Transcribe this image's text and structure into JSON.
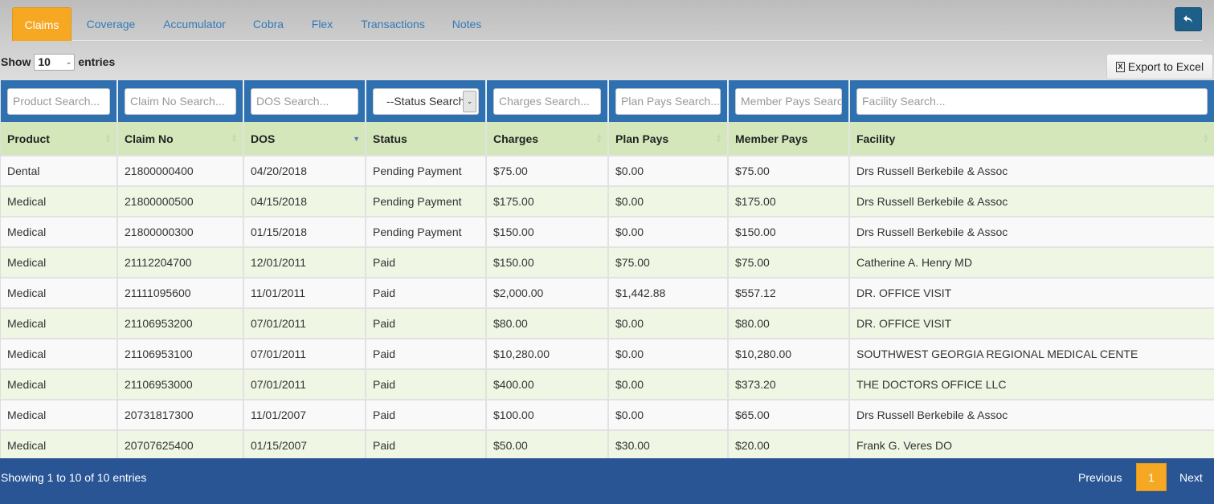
{
  "tabs": [
    "Claims",
    "Coverage",
    "Accumulator",
    "Cobra",
    "Flex",
    "Transactions",
    "Notes"
  ],
  "active_tab": "Claims",
  "length_menu": {
    "prefix": "Show",
    "value": "10",
    "suffix": "entries"
  },
  "export_label": "Export to Excel",
  "search": {
    "product": "Product Search...",
    "claim_no": "Claim No Search...",
    "dos": "DOS Search...",
    "status": "--Status Search--",
    "charges": "Charges Search...",
    "plan_pays": "Plan Pays Search...",
    "member_pays": "Member Pays Search...",
    "facility": "Facility Search..."
  },
  "columns": [
    "Product",
    "Claim No",
    "DOS",
    "Status",
    "Charges",
    "Plan Pays",
    "Member Pays",
    "Facility"
  ],
  "sorted_column": "DOS",
  "sort_direction": "desc",
  "rows": [
    [
      "Dental",
      "21800000400",
      "04/20/2018",
      "Pending Payment",
      "$75.00",
      "$0.00",
      "$75.00",
      "Drs Russell Berkebile & Assoc"
    ],
    [
      "Medical",
      "21800000500",
      "04/15/2018",
      "Pending Payment",
      "$175.00",
      "$0.00",
      "$175.00",
      "Drs Russell Berkebile & Assoc"
    ],
    [
      "Medical",
      "21800000300",
      "01/15/2018",
      "Pending Payment",
      "$150.00",
      "$0.00",
      "$150.00",
      "Drs Russell Berkebile & Assoc"
    ],
    [
      "Medical",
      "21112204700",
      "12/01/2011",
      "Paid",
      "$150.00",
      "$75.00",
      "$75.00",
      "Catherine A. Henry MD"
    ],
    [
      "Medical",
      "21111095600",
      "11/01/2011",
      "Paid",
      "$2,000.00",
      "$1,442.88",
      "$557.12",
      "DR. OFFICE VISIT"
    ],
    [
      "Medical",
      "21106953200",
      "07/01/2011",
      "Paid",
      "$80.00",
      "$0.00",
      "$80.00",
      "DR. OFFICE VISIT"
    ],
    [
      "Medical",
      "21106953100",
      "07/01/2011",
      "Paid",
      "$10,280.00",
      "$0.00",
      "$10,280.00",
      "SOUTHWEST GEORGIA REGIONAL MEDICAL CENTE"
    ],
    [
      "Medical",
      "21106953000",
      "07/01/2011",
      "Paid",
      "$400.00",
      "$0.00",
      "$373.20",
      "THE DOCTORS OFFICE LLC"
    ],
    [
      "Medical",
      "20731817300",
      "11/01/2007",
      "Paid",
      "$100.00",
      "$0.00",
      "$65.00",
      "Drs Russell Berkebile & Assoc"
    ],
    [
      "Medical",
      "20707625400",
      "01/15/2007",
      "Paid",
      "$50.00",
      "$30.00",
      "$20.00",
      "Frank G. Veres DO"
    ]
  ],
  "footer": {
    "info": "Showing 1 to 10 of 10 entries",
    "previous": "Previous",
    "page": "1",
    "next": "Next"
  },
  "colors": {
    "accent_orange": "#f7a823",
    "header_blue": "#2f70b0",
    "footer_blue": "#2a5595",
    "header_green": "#d4e7bb",
    "row_even": "#eff6e4"
  },
  "icons": {
    "back": "reply-arrow-icon",
    "export": "excel-file-icon"
  }
}
